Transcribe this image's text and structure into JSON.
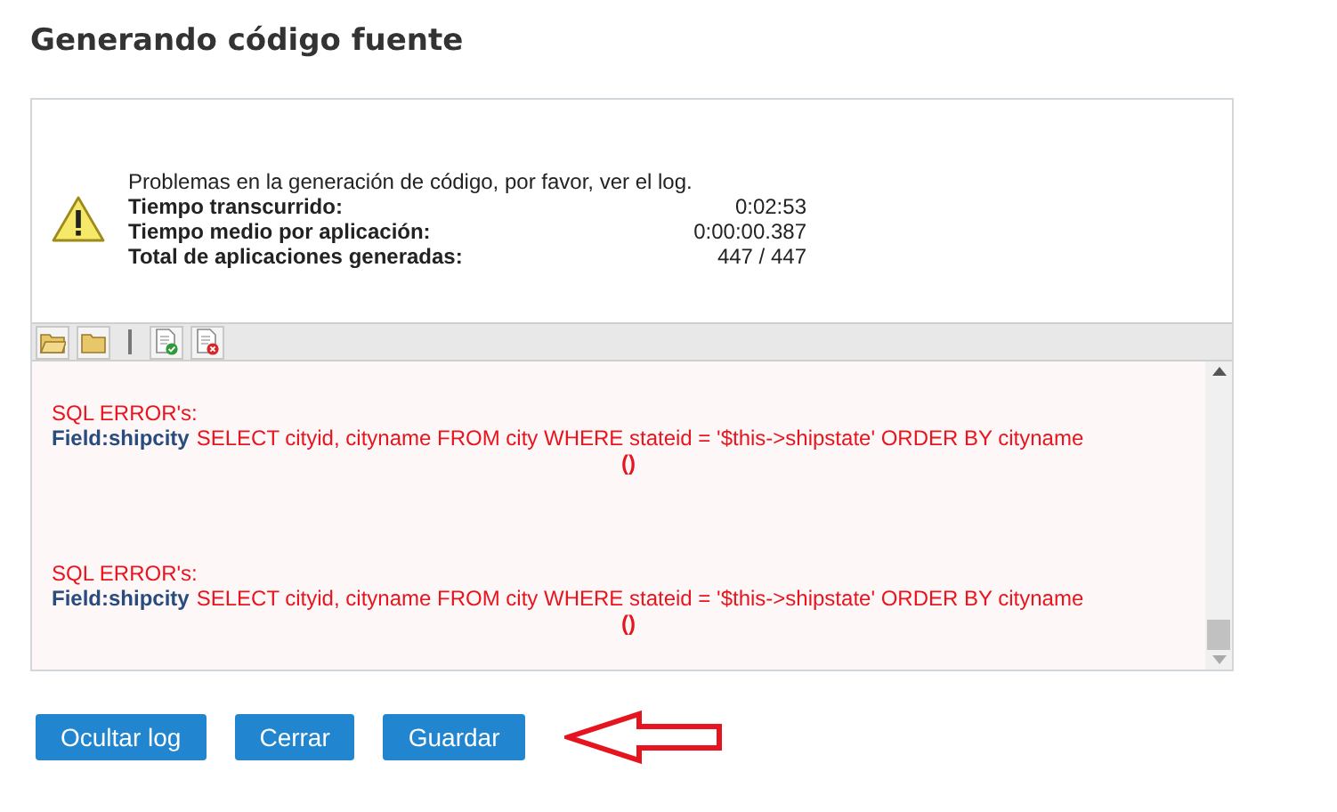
{
  "title": "Generando código fuente",
  "summary": {
    "message": "Problemas en la generación de código, por favor, ver el log.",
    "stats": [
      {
        "label": "Tiempo transcurrido:",
        "value": "0:02:53"
      },
      {
        "label": "Tiempo medio por aplicación:",
        "value": "0:00:00.387"
      },
      {
        "label": "Total de aplicaciones generadas:",
        "value": "447 / 447"
      }
    ]
  },
  "toolbar": [
    {
      "kind": "folder-open"
    },
    {
      "kind": "folder"
    },
    {
      "kind": "separator"
    },
    {
      "kind": "file-ok"
    },
    {
      "kind": "file-error"
    }
  ],
  "log": [
    {
      "heading": "SQL ERROR's:",
      "field": "Field:shipcity",
      "query": "SELECT cityid, cityname FROM city WHERE stateid = '$this->shipstate' ORDER BY cityname",
      "detail": "()"
    },
    {
      "heading": "SQL ERROR's:",
      "field": "Field:shipcity",
      "query": "SELECT cityid, cityname FROM city WHERE stateid = '$this->shipstate' ORDER BY cityname",
      "detail": "()"
    }
  ],
  "buttons": [
    "Ocultar log",
    "Cerrar",
    "Guardar"
  ]
}
